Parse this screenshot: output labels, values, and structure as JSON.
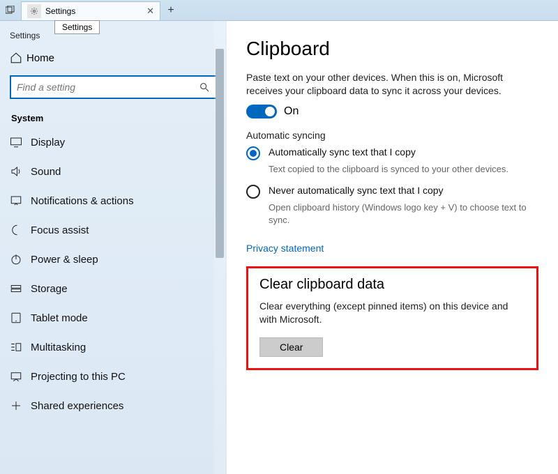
{
  "titlebar": {
    "tab_label": "Settings",
    "tooltip": "Settings"
  },
  "sidebar": {
    "app_title": "Settings",
    "home": "Home",
    "search_placeholder": "Find a setting",
    "group": "System",
    "items": [
      {
        "label": "Display"
      },
      {
        "label": "Sound"
      },
      {
        "label": "Notifications & actions"
      },
      {
        "label": "Focus assist"
      },
      {
        "label": "Power & sleep"
      },
      {
        "label": "Storage"
      },
      {
        "label": "Tablet mode"
      },
      {
        "label": "Multitasking"
      },
      {
        "label": "Projecting to this PC"
      },
      {
        "label": "Shared experiences"
      }
    ]
  },
  "main": {
    "title": "Clipboard",
    "intro": "Paste text on your other devices. When this is on, Microsoft receives your clipboard data to sync it across your devices.",
    "toggle_label": "On",
    "auto_heading": "Automatic syncing",
    "radio1_label": "Automatically sync text that I copy",
    "radio1_hint": "Text copied to the clipboard is synced to your other devices.",
    "radio2_label": "Never automatically sync text that I copy",
    "radio2_hint": "Open clipboard history (Windows logo key + V) to choose text to sync.",
    "privacy_link": "Privacy statement",
    "clear_heading": "Clear clipboard data",
    "clear_desc": "Clear everything (except pinned items) on this device and with Microsoft.",
    "clear_button": "Clear"
  }
}
